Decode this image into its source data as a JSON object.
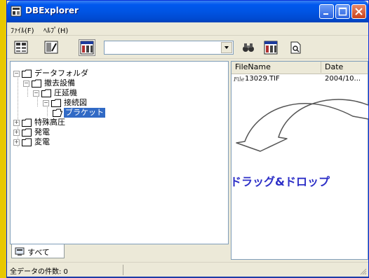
{
  "window": {
    "title": "DBExplorer"
  },
  "menu": {
    "items": [
      "ﾌｧｲﾙ(F)",
      "ﾍﾙﾌﾟ(H)"
    ]
  },
  "toolbar": {
    "combo_value": ""
  },
  "tree": {
    "nodes": [
      "データフォルダ",
      "撤去設備",
      "圧延機",
      "接続図",
      "ブラケット",
      "特殊高圧",
      "発電",
      "変電"
    ]
  },
  "tabs": {
    "all_label": "すべて"
  },
  "list": {
    "columns": [
      "FileName",
      "Date"
    ],
    "rows": [
      {
        "icon_text": "File",
        "name": "13029.TIF",
        "date": "2004/10..."
      }
    ]
  },
  "status": {
    "text": "全データの件数: 0"
  },
  "annotation": {
    "caption": "ドラッグ&ドロップ"
  },
  "colors": {
    "title_bar": "#0054e3",
    "selection": "#316ac5",
    "caption": "#2d2fc7",
    "side_bar": "#e8c800"
  }
}
